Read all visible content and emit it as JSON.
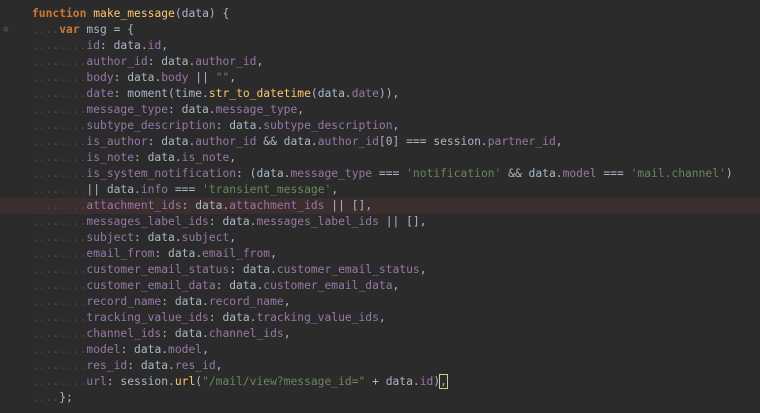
{
  "colors": {
    "background": "#2b2b2b",
    "keyword": "#cc7832",
    "function_name": "#ffc66d",
    "plain": "#a9b7c6",
    "property": "#9876aa",
    "string": "#6a8759",
    "highlight_line": "#3b2e2e"
  },
  "gutter_icons": [
    "fold-open-icon",
    "fold-open-icon"
  ],
  "lines": [
    {
      "fold": "",
      "indent": "",
      "tokens": [
        {
          "t": "kw",
          "v": "function"
        },
        {
          "t": "pl",
          "v": " "
        },
        {
          "t": "fn",
          "v": "make_message"
        },
        {
          "t": "pl",
          "v": "(data) {"
        }
      ]
    },
    {
      "fold": "⊖",
      "indent": "....",
      "tokens": [
        {
          "t": "kw",
          "v": "var"
        },
        {
          "t": "pl",
          "v": " msg = {"
        }
      ]
    },
    {
      "fold": "",
      "indent": "........",
      "tokens": [
        {
          "t": "ky",
          "v": "id"
        },
        {
          "t": "pl",
          "v": ": data."
        },
        {
          "t": "pr",
          "v": "id"
        },
        {
          "t": "pl",
          "v": ","
        }
      ]
    },
    {
      "fold": "",
      "indent": "........",
      "tokens": [
        {
          "t": "ky",
          "v": "author_id"
        },
        {
          "t": "pl",
          "v": ": data."
        },
        {
          "t": "pr",
          "v": "author_id"
        },
        {
          "t": "pl",
          "v": ","
        }
      ]
    },
    {
      "fold": "",
      "indent": "........",
      "tokens": [
        {
          "t": "ky",
          "v": "body"
        },
        {
          "t": "pl",
          "v": ": data."
        },
        {
          "t": "pr",
          "v": "body"
        },
        {
          "t": "pl",
          "v": " || "
        },
        {
          "t": "st",
          "v": "\"\""
        },
        {
          "t": "pl",
          "v": ","
        }
      ]
    },
    {
      "fold": "",
      "indent": "........",
      "tokens": [
        {
          "t": "ky",
          "v": "date"
        },
        {
          "t": "pl",
          "v": ": moment(time."
        },
        {
          "t": "fn",
          "v": "str_to_datetime"
        },
        {
          "t": "pl",
          "v": "(data."
        },
        {
          "t": "pr",
          "v": "date"
        },
        {
          "t": "pl",
          "v": ")),"
        }
      ]
    },
    {
      "fold": "",
      "indent": "........",
      "tokens": [
        {
          "t": "ky",
          "v": "message_type"
        },
        {
          "t": "pl",
          "v": ": data."
        },
        {
          "t": "pr",
          "v": "message_type"
        },
        {
          "t": "pl",
          "v": ","
        }
      ]
    },
    {
      "fold": "",
      "indent": "........",
      "tokens": [
        {
          "t": "ky",
          "v": "subtype_description"
        },
        {
          "t": "pl",
          "v": ": data."
        },
        {
          "t": "pr",
          "v": "subtype_description"
        },
        {
          "t": "pl",
          "v": ","
        }
      ]
    },
    {
      "fold": "",
      "indent": "........",
      "tokens": [
        {
          "t": "ky",
          "v": "is_author"
        },
        {
          "t": "pl",
          "v": ": data."
        },
        {
          "t": "pr",
          "v": "author_id"
        },
        {
          "t": "pl",
          "v": " && data."
        },
        {
          "t": "pr",
          "v": "author_id"
        },
        {
          "t": "pl",
          "v": "[0] === session."
        },
        {
          "t": "pr",
          "v": "partner_id"
        },
        {
          "t": "pl",
          "v": ","
        }
      ]
    },
    {
      "fold": "",
      "indent": "........",
      "tokens": [
        {
          "t": "ky",
          "v": "is_note"
        },
        {
          "t": "pl",
          "v": ": data."
        },
        {
          "t": "pr",
          "v": "is_note"
        },
        {
          "t": "pl",
          "v": ","
        }
      ]
    },
    {
      "fold": "",
      "indent": "........",
      "tokens": [
        {
          "t": "ky",
          "v": "is_system_notification"
        },
        {
          "t": "pl",
          "v": ": (data."
        },
        {
          "t": "pr",
          "v": "message_type"
        },
        {
          "t": "pl",
          "v": " === "
        },
        {
          "t": "st",
          "v": "'notification'"
        },
        {
          "t": "pl",
          "v": " && data."
        },
        {
          "t": "pr",
          "v": "model"
        },
        {
          "t": "pl",
          "v": " === "
        },
        {
          "t": "st",
          "v": "'mail.channel'"
        },
        {
          "t": "pl",
          "v": ")"
        }
      ]
    },
    {
      "fold": "",
      "indent": "........",
      "tokens": [
        {
          "t": "pl",
          "v": "|| data."
        },
        {
          "t": "pr",
          "v": "info"
        },
        {
          "t": "pl",
          "v": " === "
        },
        {
          "t": "st",
          "v": "'transient_message'"
        },
        {
          "t": "pl",
          "v": ","
        }
      ]
    },
    {
      "fold": "",
      "indent": "........",
      "hl": true,
      "tokens": [
        {
          "t": "ky",
          "v": "attachment_ids"
        },
        {
          "t": "pl",
          "v": ": data."
        },
        {
          "t": "pr",
          "v": "attachment_ids"
        },
        {
          "t": "pl",
          "v": " || [],"
        }
      ]
    },
    {
      "fold": "",
      "indent": "........",
      "tokens": [
        {
          "t": "ky",
          "v": "messages_label_ids"
        },
        {
          "t": "pl",
          "v": ": data."
        },
        {
          "t": "pr",
          "v": "messages_label_ids"
        },
        {
          "t": "pl",
          "v": " || [],"
        }
      ]
    },
    {
      "fold": "",
      "indent": "........",
      "tokens": [
        {
          "t": "ky",
          "v": "subject"
        },
        {
          "t": "pl",
          "v": ": data."
        },
        {
          "t": "pr",
          "v": "subject"
        },
        {
          "t": "pl",
          "v": ","
        }
      ]
    },
    {
      "fold": "",
      "indent": "........",
      "tokens": [
        {
          "t": "ky",
          "v": "email_from"
        },
        {
          "t": "pl",
          "v": ": data."
        },
        {
          "t": "pr",
          "v": "email_from"
        },
        {
          "t": "pl",
          "v": ","
        }
      ]
    },
    {
      "fold": "",
      "indent": "........",
      "tokens": [
        {
          "t": "ky",
          "v": "customer_email_status"
        },
        {
          "t": "pl",
          "v": ": data."
        },
        {
          "t": "pr",
          "v": "customer_email_status"
        },
        {
          "t": "pl",
          "v": ","
        }
      ]
    },
    {
      "fold": "",
      "indent": "........",
      "tokens": [
        {
          "t": "ky",
          "v": "customer_email_data"
        },
        {
          "t": "pl",
          "v": ": data."
        },
        {
          "t": "pr",
          "v": "customer_email_data"
        },
        {
          "t": "pl",
          "v": ","
        }
      ]
    },
    {
      "fold": "",
      "indent": "........",
      "tokens": [
        {
          "t": "ky",
          "v": "record_name"
        },
        {
          "t": "pl",
          "v": ": data."
        },
        {
          "t": "pr",
          "v": "record_name"
        },
        {
          "t": "pl",
          "v": ","
        }
      ]
    },
    {
      "fold": "",
      "indent": "........",
      "tokens": [
        {
          "t": "ky",
          "v": "tracking_value_ids"
        },
        {
          "t": "pl",
          "v": ": data."
        },
        {
          "t": "pr",
          "v": "tracking_value_ids"
        },
        {
          "t": "pl",
          "v": ","
        }
      ]
    },
    {
      "fold": "",
      "indent": "........",
      "tokens": [
        {
          "t": "ky",
          "v": "channel_ids"
        },
        {
          "t": "pl",
          "v": ": data."
        },
        {
          "t": "pr",
          "v": "channel_ids"
        },
        {
          "t": "pl",
          "v": ","
        }
      ]
    },
    {
      "fold": "",
      "indent": "........",
      "tokens": [
        {
          "t": "ky",
          "v": "model"
        },
        {
          "t": "pl",
          "v": ": data."
        },
        {
          "t": "pr",
          "v": "model"
        },
        {
          "t": "pl",
          "v": ","
        }
      ]
    },
    {
      "fold": "",
      "indent": "........",
      "tokens": [
        {
          "t": "ky",
          "v": "res_id"
        },
        {
          "t": "pl",
          "v": ": data."
        },
        {
          "t": "pr",
          "v": "res_id"
        },
        {
          "t": "pl",
          "v": ","
        }
      ]
    },
    {
      "fold": "",
      "indent": "........",
      "cursor": true,
      "tokens": [
        {
          "t": "ky",
          "v": "url"
        },
        {
          "t": "pl",
          "v": ": session."
        },
        {
          "t": "fn",
          "v": "url"
        },
        {
          "t": "pl",
          "v": "("
        },
        {
          "t": "st",
          "v": "\"/mail/view?message_id=\""
        },
        {
          "t": "pl",
          "v": " + data."
        },
        {
          "t": "pr",
          "v": "id"
        },
        {
          "t": "pl",
          "v": ")"
        },
        {
          "t": "pl",
          "v": ","
        }
      ]
    },
    {
      "fold": "",
      "indent": "....",
      "tokens": [
        {
          "t": "pl",
          "v": "};"
        }
      ]
    }
  ]
}
